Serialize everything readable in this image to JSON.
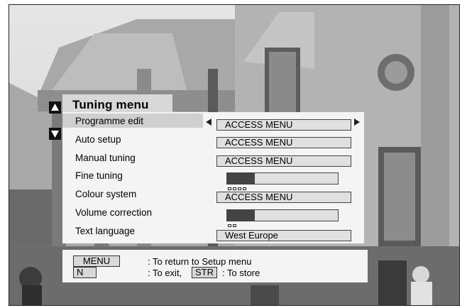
{
  "menu": {
    "title": "Tuning menu",
    "rows": [
      {
        "label": "Programme edit",
        "kind": "value",
        "value": "ACCESS MENU",
        "selected": true
      },
      {
        "label": "Auto setup",
        "kind": "value",
        "value": "ACCESS MENU",
        "selected": false
      },
      {
        "label": "Manual tuning",
        "kind": "value",
        "value": "ACCESS MENU",
        "selected": false
      },
      {
        "label": "Fine tuning",
        "kind": "bar",
        "level": 0.25,
        "dot_count": 4,
        "selected": false
      },
      {
        "label": "Colour system",
        "kind": "value",
        "value": "ACCESS MENU",
        "selected": false
      },
      {
        "label": "Volume correction",
        "kind": "bar",
        "level": 0.25,
        "dot_count": 2,
        "selected": false
      },
      {
        "label": "Text language",
        "kind": "value",
        "value": "West Europe",
        "selected": false
      }
    ]
  },
  "footer": {
    "menu_key": "MENU",
    "menu_desc": ": To return to Setup menu",
    "n_key": "N",
    "exit_desc": ": To exit,",
    "str_key": "STR",
    "store_desc": ": To store"
  },
  "icons": {
    "up": "up-arrow-icon",
    "down": "down-arrow-icon",
    "left": "left-arrow-icon",
    "right": "right-arrow-icon"
  },
  "colors": {
    "panel": "#f4f4f4",
    "highlight": "#cfcfcf",
    "bar_fill": "#444444"
  }
}
